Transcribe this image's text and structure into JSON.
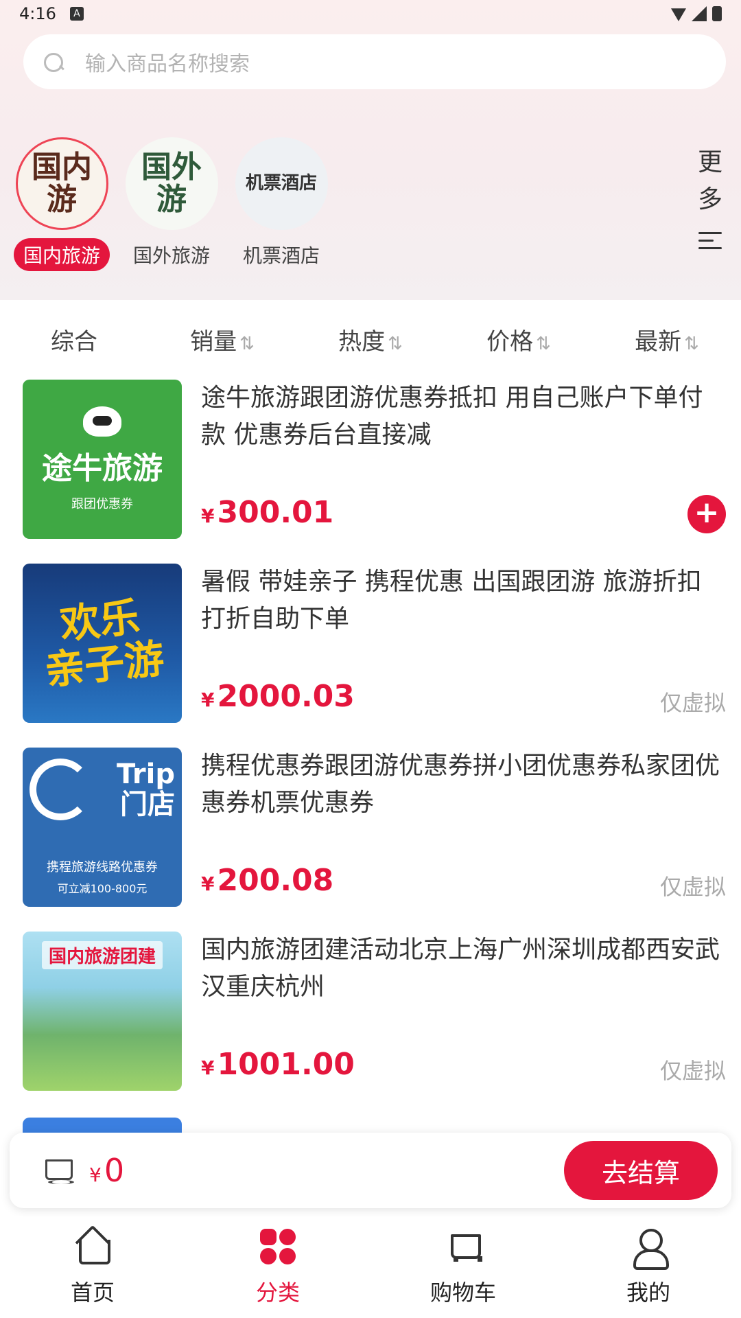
{
  "status_bar": {
    "time": "4:16"
  },
  "search": {
    "placeholder": "输入商品名称搜索"
  },
  "categories": [
    {
      "label": "国内旅游",
      "art": "国内\n游",
      "active": true
    },
    {
      "label": "国外旅游",
      "art": "国外\n游",
      "active": false
    },
    {
      "label": "机票酒店",
      "art": "机票酒店",
      "active": false
    }
  ],
  "more": {
    "line1": "更",
    "line2": "多"
  },
  "sort": [
    {
      "label": "综合",
      "arrow": ""
    },
    {
      "label": "销量",
      "arrow": "⇅"
    },
    {
      "label": "热度",
      "arrow": "⇅"
    },
    {
      "label": "价格",
      "arrow": "⇅"
    },
    {
      "label": "最新",
      "arrow": "⇅"
    }
  ],
  "products": [
    {
      "title": "途牛旅游跟团游优惠券抵扣 用自己账户下单付款 优惠券后台直接减",
      "currency": "¥",
      "price": "300.01",
      "image": {
        "big": "途牛旅游",
        "small": "跟团优惠券"
      },
      "add_label": "+"
    },
    {
      "title": "暑假 带娃亲子 携程优惠 出国跟团游 旅游折扣 打折自助下单",
      "currency": "¥",
      "price": "2000.03",
      "virtual": "仅虚拟",
      "image": {
        "big": "欢乐\n亲子游"
      }
    },
    {
      "title": "携程优惠券跟团游优惠券拼小团优惠券私家团优惠券机票优惠券",
      "currency": "¥",
      "price": "200.08",
      "virtual": "仅虚拟",
      "image": {
        "brand": "Trip\n门店",
        "line1": "携程旅游线路优惠券",
        "line2": "可立减100-800元"
      }
    },
    {
      "title": "国内旅游团建活动北京上海广州深圳成都西安武汉重庆杭州",
      "currency": "¥",
      "price": "1001.00",
      "virtual": "仅虚拟",
      "image": {
        "tag": "国内旅游团建"
      }
    }
  ],
  "cart_bar": {
    "currency": "¥",
    "total": "0",
    "checkout_label": "去结算"
  },
  "tabbar": [
    {
      "label": "首页",
      "icon": "home-icon"
    },
    {
      "label": "分类",
      "icon": "grid-icon",
      "active": true
    },
    {
      "label": "购物车",
      "icon": "cart-icon"
    },
    {
      "label": "我的",
      "icon": "user-icon"
    }
  ],
  "colors": {
    "accent": "#e4163d",
    "tuniu_green": "#3fa844",
    "trip_blue": "#2f6cb3"
  }
}
